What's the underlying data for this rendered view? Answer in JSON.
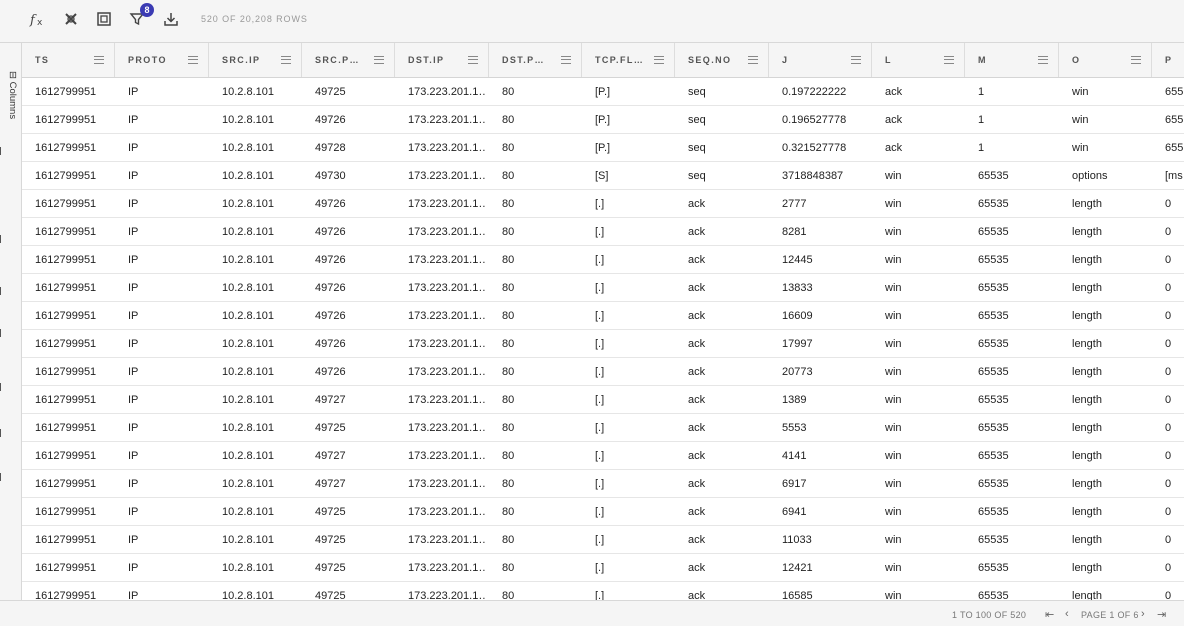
{
  "toolbar": {
    "icons": [
      "fx-icon",
      "layers-icon",
      "frame-icon",
      "filter-icon",
      "download-icon"
    ],
    "filter_badge": "8",
    "row_count": "520 OF 20,208 ROWS"
  },
  "sidebar": {
    "columns_label": "Columns"
  },
  "columns": [
    {
      "label": "TS"
    },
    {
      "label": "PROTO"
    },
    {
      "label": "SRC.IP"
    },
    {
      "label": "SRC.P…"
    },
    {
      "label": "DST.IP"
    },
    {
      "label": "DST.P…"
    },
    {
      "label": "TCP.FL…"
    },
    {
      "label": "SEQ.NO"
    },
    {
      "label": "J"
    },
    {
      "label": "L"
    },
    {
      "label": "M"
    },
    {
      "label": "O"
    },
    {
      "label": "P"
    }
  ],
  "rows": [
    [
      "1612799951",
      "IP",
      "10.2.8.101",
      "49725",
      "173.223.201.1…",
      "80",
      "[P.]",
      "seq",
      "0.197222222",
      "ack",
      "1",
      "win",
      "655"
    ],
    [
      "1612799951",
      "IP",
      "10.2.8.101",
      "49726",
      "173.223.201.1…",
      "80",
      "[P.]",
      "seq",
      "0.196527778",
      "ack",
      "1",
      "win",
      "655"
    ],
    [
      "1612799951",
      "IP",
      "10.2.8.101",
      "49728",
      "173.223.201.1…",
      "80",
      "[P.]",
      "seq",
      "0.321527778",
      "ack",
      "1",
      "win",
      "655"
    ],
    [
      "1612799951",
      "IP",
      "10.2.8.101",
      "49730",
      "173.223.201.1…",
      "80",
      "[S]",
      "seq",
      "3718848387",
      "win",
      "65535",
      "options",
      "[ms"
    ],
    [
      "1612799951",
      "IP",
      "10.2.8.101",
      "49726",
      "173.223.201.1…",
      "80",
      "[.]",
      "ack",
      "2777",
      "win",
      "65535",
      "length",
      "0"
    ],
    [
      "1612799951",
      "IP",
      "10.2.8.101",
      "49726",
      "173.223.201.1…",
      "80",
      "[.]",
      "ack",
      "8281",
      "win",
      "65535",
      "length",
      "0"
    ],
    [
      "1612799951",
      "IP",
      "10.2.8.101",
      "49726",
      "173.223.201.1…",
      "80",
      "[.]",
      "ack",
      "12445",
      "win",
      "65535",
      "length",
      "0"
    ],
    [
      "1612799951",
      "IP",
      "10.2.8.101",
      "49726",
      "173.223.201.1…",
      "80",
      "[.]",
      "ack",
      "13833",
      "win",
      "65535",
      "length",
      "0"
    ],
    [
      "1612799951",
      "IP",
      "10.2.8.101",
      "49726",
      "173.223.201.1…",
      "80",
      "[.]",
      "ack",
      "16609",
      "win",
      "65535",
      "length",
      "0"
    ],
    [
      "1612799951",
      "IP",
      "10.2.8.101",
      "49726",
      "173.223.201.1…",
      "80",
      "[.]",
      "ack",
      "17997",
      "win",
      "65535",
      "length",
      "0"
    ],
    [
      "1612799951",
      "IP",
      "10.2.8.101",
      "49726",
      "173.223.201.1…",
      "80",
      "[.]",
      "ack",
      "20773",
      "win",
      "65535",
      "length",
      "0"
    ],
    [
      "1612799951",
      "IP",
      "10.2.8.101",
      "49727",
      "173.223.201.1…",
      "80",
      "[.]",
      "ack",
      "1389",
      "win",
      "65535",
      "length",
      "0"
    ],
    [
      "1612799951",
      "IP",
      "10.2.8.101",
      "49725",
      "173.223.201.1…",
      "80",
      "[.]",
      "ack",
      "5553",
      "win",
      "65535",
      "length",
      "0"
    ],
    [
      "1612799951",
      "IP",
      "10.2.8.101",
      "49727",
      "173.223.201.1…",
      "80",
      "[.]",
      "ack",
      "4141",
      "win",
      "65535",
      "length",
      "0"
    ],
    [
      "1612799951",
      "IP",
      "10.2.8.101",
      "49727",
      "173.223.201.1…",
      "80",
      "[.]",
      "ack",
      "6917",
      "win",
      "65535",
      "length",
      "0"
    ],
    [
      "1612799951",
      "IP",
      "10.2.8.101",
      "49725",
      "173.223.201.1…",
      "80",
      "[.]",
      "ack",
      "6941",
      "win",
      "65535",
      "length",
      "0"
    ],
    [
      "1612799951",
      "IP",
      "10.2.8.101",
      "49725",
      "173.223.201.1…",
      "80",
      "[.]",
      "ack",
      "11033",
      "win",
      "65535",
      "length",
      "0"
    ],
    [
      "1612799951",
      "IP",
      "10.2.8.101",
      "49725",
      "173.223.201.1…",
      "80",
      "[.]",
      "ack",
      "12421",
      "win",
      "65535",
      "length",
      "0"
    ],
    [
      "1612799951",
      "IP",
      "10.2.8.101",
      "49725",
      "173.223.201.1…",
      "80",
      "[.]",
      "ack",
      "16585",
      "win",
      "65535",
      "length",
      "0"
    ]
  ],
  "footer": {
    "range": "1 TO 100 OF 520",
    "page_label": "PAGE 1 OF 6",
    "nav": [
      "first-page-icon",
      "prev-page-icon",
      "next-page-icon",
      "last-page-icon"
    ]
  }
}
